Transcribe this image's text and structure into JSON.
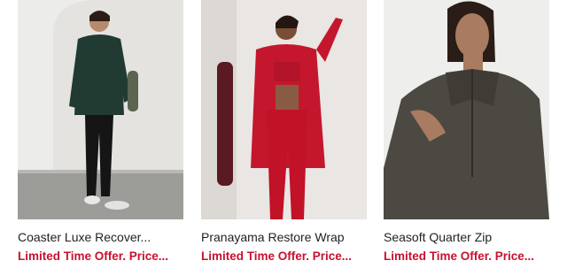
{
  "colors": {
    "offer_text": "#c8102e",
    "title_text": "#222222"
  },
  "products": [
    {
      "title": "Coaster Luxe Recover...",
      "offer": "Limited Time Offer. Price...",
      "image_icon": "product-photo-icon"
    },
    {
      "title": "Pranayama Restore Wrap",
      "offer": "Limited Time Offer. Price...",
      "image_icon": "product-photo-icon"
    },
    {
      "title": "Seasoft Quarter Zip",
      "offer": "Limited Time Offer. Price...",
      "image_icon": "product-photo-icon"
    }
  ]
}
